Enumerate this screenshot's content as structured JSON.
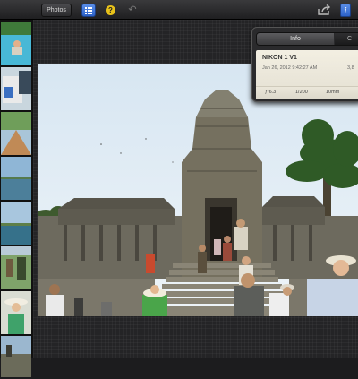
{
  "toolbar": {
    "photos_label": "Photos",
    "help_label": "?",
    "info_label": "i"
  },
  "inspector": {
    "tab_info": "Info",
    "tab_other": "C",
    "camera": "NIKON 1 V1",
    "date": "Jan 26, 2012 9:42:27 AM",
    "size": "3,8",
    "aperture": "ƒ/6.3",
    "shutter": "1/200",
    "focal": "10mm"
  },
  "colors": {
    "accent_blue": "#2d62c8",
    "help_yellow": "#e8c21a"
  }
}
